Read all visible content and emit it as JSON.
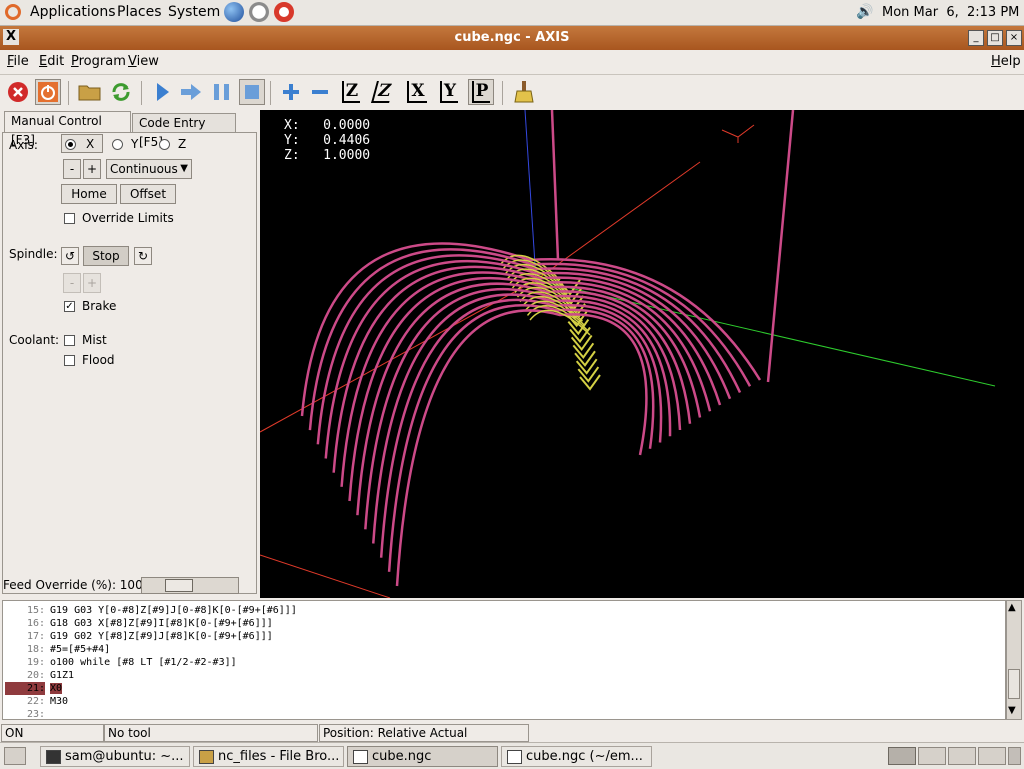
{
  "top_panel": {
    "menus": [
      "Applications",
      "Places",
      "System"
    ],
    "clock": "Mon Mar  6,  2:13 PM"
  },
  "window": {
    "title": "cube.ngc - AXIS",
    "menus": [
      {
        "key": "F",
        "rest": "ile"
      },
      {
        "key": "E",
        "rest": "dit"
      },
      {
        "key": "P",
        "rest": "rogram"
      },
      {
        "key": "V",
        "rest": "iew"
      }
    ],
    "help": {
      "key": "H",
      "rest": "elp"
    }
  },
  "toolbar": {
    "icons": [
      "estop-icon",
      "machine-power-icon",
      "open-file-icon",
      "reload-icon",
      "run-icon",
      "step-icon",
      "pause-icon",
      "stop-icon",
      "zoom-in-icon",
      "zoom-out-icon",
      "view-z-icon",
      "view-z-rotated-icon",
      "view-x-icon",
      "view-y-icon",
      "view-perspective-icon",
      "clear-plot-icon"
    ],
    "view_labels": {
      "z": "Z",
      "z2": "Z",
      "x": "X",
      "y": "Y",
      "p": "P"
    }
  },
  "manual_control": {
    "tabs": [
      "Manual Control [F3]",
      "Code Entry [F5]"
    ],
    "axis_label": "Axis:",
    "axes": [
      "X",
      "Y",
      "Z"
    ],
    "selected_axis": "X",
    "jog_minus": "-",
    "jog_plus": "+",
    "jog_mode": "Continuous",
    "home_button": "Home",
    "offset_button": "Offset",
    "override_limits": "Override Limits",
    "override_limits_checked": false,
    "spindle_label": "Spindle:",
    "spindle_stop": "Stop",
    "speed_minus": "-",
    "speed_plus": "+",
    "brake_label": "Brake",
    "brake_checked": true,
    "coolant_label": "Coolant:",
    "mist_label": "Mist",
    "mist_checked": false,
    "flood_label": "Flood",
    "flood_checked": false,
    "feed_override_label": "Feed Override (%): 100",
    "feed_override_value": 100
  },
  "dro": {
    "lines": [
      "X:   0.0000",
      "Y:   0.4406",
      "Z:   1.0000"
    ]
  },
  "code_lines": [
    {
      "num": "15:",
      "text": "G19 G03 Y[0-#8]Z[#9]J[0-#8]K[0-[#9+[#6]]]"
    },
    {
      "num": "16:",
      "text": "G18 G03 X[#8]Z[#9]I[#8]K[0-[#9+[#6]]]"
    },
    {
      "num": "17:",
      "text": "G19 G02 Y[#8]Z[#9]J[#8]K[0-[#9+[#6]]]"
    },
    {
      "num": "18:",
      "text": "#5=[#5+#4]"
    },
    {
      "num": "19:",
      "text": "o100 while [#8 LT [#1/2-#2-#3]]"
    },
    {
      "num": "20:",
      "text": "G1Z1"
    },
    {
      "num": "21:",
      "text": "X0",
      "highlight": true
    },
    {
      "num": "22:",
      "text": "M30"
    },
    {
      "num": "23:",
      "text": ""
    }
  ],
  "status": {
    "state": "ON",
    "tool": "No tool",
    "position": "Position: Relative Actual"
  },
  "taskbar": {
    "tasks": [
      "sam@ubuntu: ~...",
      "nc_files - File Bro...",
      "cube.ngc",
      "cube.ngc (~/em..."
    ],
    "active_task": "cube.ngc"
  },
  "colors": {
    "title_bar": "#b86a31",
    "tool_path_feed": "#cc4a88",
    "tool_path_plane": "#d4d044",
    "x_axis": "#e03a2a",
    "y_axis": "#2ecc2e",
    "z_axis": "#3448e0",
    "code_highlight": "#8f3b3e"
  }
}
